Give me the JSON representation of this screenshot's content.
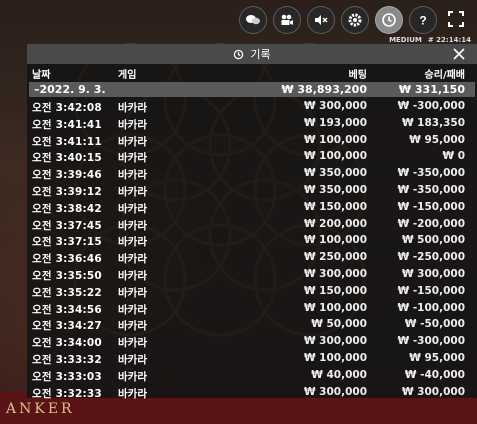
{
  "toolbar": {
    "icons": [
      "chat-icon",
      "video-icon",
      "mute-icon",
      "settings-icon",
      "history-icon",
      "help-icon",
      "fullscreen-icon"
    ],
    "quality": "MEDIUM",
    "clock": "# 22:14:14"
  },
  "panel": {
    "title": "기록",
    "columns": {
      "date": "날짜",
      "game": "게임",
      "bet": "베팅",
      "result": "승리/패배"
    },
    "summary": {
      "date": "–2022. 9. 3.",
      "bet": "₩ 38,893,200",
      "result": "₩ 331,150"
    },
    "rows": [
      {
        "date": "오전 3:42:08",
        "game": "바카라",
        "bet": "₩ 300,000",
        "result": "₩ -300,000"
      },
      {
        "date": "오전 3:41:41",
        "game": "바카라",
        "bet": "₩ 193,000",
        "result": "₩ 183,350"
      },
      {
        "date": "오전 3:41:11",
        "game": "바카라",
        "bet": "₩ 100,000",
        "result": "₩ 95,000"
      },
      {
        "date": "오전 3:40:15",
        "game": "바카라",
        "bet": "₩ 100,000",
        "result": "₩ 0"
      },
      {
        "date": "오전 3:39:46",
        "game": "바카라",
        "bet": "₩ 350,000",
        "result": "₩ -350,000"
      },
      {
        "date": "오전 3:39:12",
        "game": "바카라",
        "bet": "₩ 350,000",
        "result": "₩ -350,000"
      },
      {
        "date": "오전 3:38:42",
        "game": "바카라",
        "bet": "₩ 150,000",
        "result": "₩ -150,000"
      },
      {
        "date": "오전 3:37:45",
        "game": "바카라",
        "bet": "₩ 200,000",
        "result": "₩ -200,000"
      },
      {
        "date": "오전 3:37:15",
        "game": "바카라",
        "bet": "₩ 100,000",
        "result": "₩ 500,000"
      },
      {
        "date": "오전 3:36:46",
        "game": "바카라",
        "bet": "₩ 250,000",
        "result": "₩ -250,000"
      },
      {
        "date": "오전 3:35:50",
        "game": "바카라",
        "bet": "₩ 300,000",
        "result": "₩ 300,000"
      },
      {
        "date": "오전 3:35:22",
        "game": "바카라",
        "bet": "₩ 150,000",
        "result": "₩ -150,000"
      },
      {
        "date": "오전 3:34:56",
        "game": "바카라",
        "bet": "₩ 100,000",
        "result": "₩ -100,000"
      },
      {
        "date": "오전 3:34:27",
        "game": "바카라",
        "bet": "₩ 50,000",
        "result": "₩ -50,000"
      },
      {
        "date": "오전 3:34:00",
        "game": "바카라",
        "bet": "₩ 300,000",
        "result": "₩ -300,000"
      },
      {
        "date": "오전 3:33:32",
        "game": "바카라",
        "bet": "₩ 100,000",
        "result": "₩ 95,000"
      },
      {
        "date": "오전 3:33:03",
        "game": "바카라",
        "bet": "₩ 40,000",
        "result": "₩ -40,000"
      },
      {
        "date": "오전 3:32:33",
        "game": "바카라",
        "bet": "₩ 300,000",
        "result": "₩ 300,000"
      }
    ]
  },
  "background": {
    "felt_text": "ANKER"
  },
  "colors": {
    "panel_bg": "#141414",
    "header_bg": "#4a4a4a",
    "summary_bg": "#5a5a5a",
    "felt": "#5a1416"
  }
}
